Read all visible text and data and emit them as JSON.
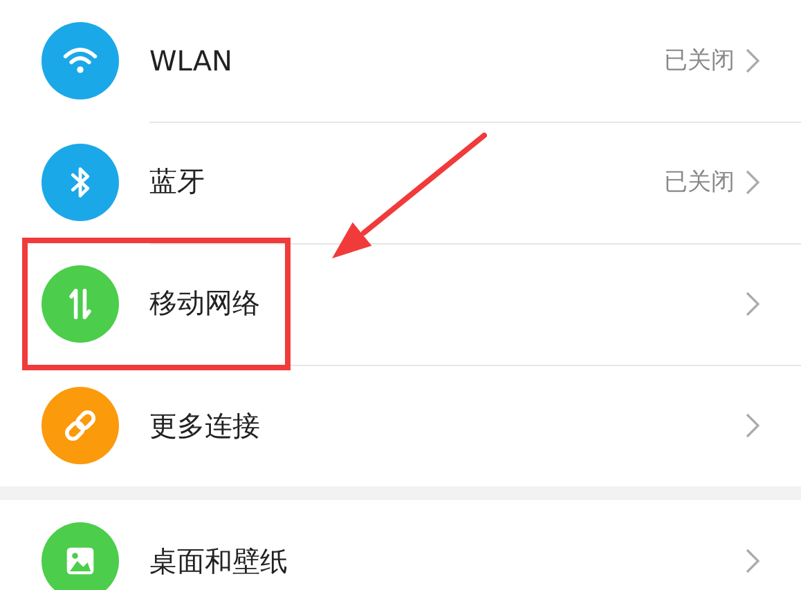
{
  "groups": [
    {
      "items": [
        {
          "kind": "wifi",
          "color": "#1ba8e8",
          "title": "WLAN",
          "status": "已关闭"
        },
        {
          "kind": "bluetooth",
          "color": "#1ba8e8",
          "title": "蓝牙",
          "status": "已关闭"
        },
        {
          "kind": "data",
          "color": "#4ccd4c",
          "title": "移动网络"
        },
        {
          "kind": "link",
          "color": "#fb9a0a",
          "title": "更多连接"
        }
      ]
    },
    {
      "items": [
        {
          "kind": "image",
          "color": "#4ccd4c",
          "title": "桌面和壁纸"
        }
      ]
    }
  ]
}
